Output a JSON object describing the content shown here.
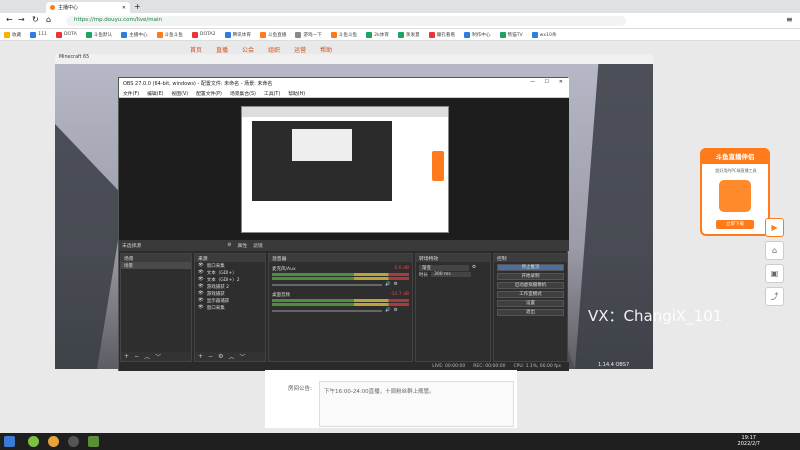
{
  "browser": {
    "tabs": [
      {
        "label": "主播中心"
      }
    ],
    "url": "https://mp.douyu.com/live/main",
    "bookmarks": [
      "收藏",
      "111",
      "DOTA",
      "斗鱼默认",
      "主播中心",
      "斗鱼斗鱼",
      "DOTA2",
      "腾讯体育",
      "斗鱼直播",
      "游戏一下",
      "斗鱼斗鱼",
      "2k体育",
      "蒸发夏",
      "瞳孔看看",
      "制作中心",
      "熊猫TV",
      "wx10条"
    ]
  },
  "site": {
    "nav": [
      "首页",
      "直播",
      "公会",
      "组织",
      "运营",
      "帮助"
    ]
  },
  "minecraft": {
    "title": "Minecraft 65"
  },
  "obs": {
    "title": "OBS 27.0.0 (64-bit, windows) - 配置文件: 未命名 - 场景: 未命名",
    "menu": [
      "文件(F)",
      "编辑(E)",
      "视图(V)",
      "配置文件(P)",
      "场景集合(S)",
      "工具(T)",
      "帮助(H)"
    ],
    "no_source": "未选择源",
    "props_btn": "属性",
    "filter_btn": "滤镜",
    "scenes_title": "场景",
    "scenes": [
      "场景"
    ],
    "sources_title": "来源",
    "sources": [
      "窗口采集",
      "文本（GDI+）",
      "文本（GDI+）2",
      "游戏捕获 2",
      "游戏捕获",
      "显示器捕获",
      "窗口采集"
    ],
    "mixer_title": "混音器",
    "mixer": [
      {
        "name": "麦克风/Aux",
        "db": "0.0 dB"
      },
      {
        "name": "桌面音频",
        "db": "-12.7 dB"
      }
    ],
    "transition_title": "转场特效",
    "transition_type": "渐变",
    "duration_label": "时长",
    "duration": "300 ms",
    "controls_title": "控制",
    "controls": [
      "停止推流",
      "开始录制",
      "启动虚拟摄像机",
      "工作室模式",
      "设置",
      "退出"
    ],
    "status": [
      "LIVE: 00:00:00",
      "REC: 00:00:00",
      "CPU: 1.1%, 60.00 fps"
    ],
    "watermark": "VX：ChangiX_101",
    "version": "1.14.4 OBS7"
  },
  "announcement": {
    "label": "房间公告:",
    "text": "下午16:00-24:00直播，十周粉丝群上舰管。"
  },
  "promo": {
    "title": "斗鱼直播伴侣",
    "subtitle": "超好用的PC端直播工具",
    "button": "立即下载"
  },
  "taskbar": {
    "time": "19:17",
    "date": "2022/2/7"
  },
  "colors": {
    "accent": "#ff7a1a",
    "obs_active": "#4d6e9e",
    "url_green": "#1a7f3c"
  }
}
